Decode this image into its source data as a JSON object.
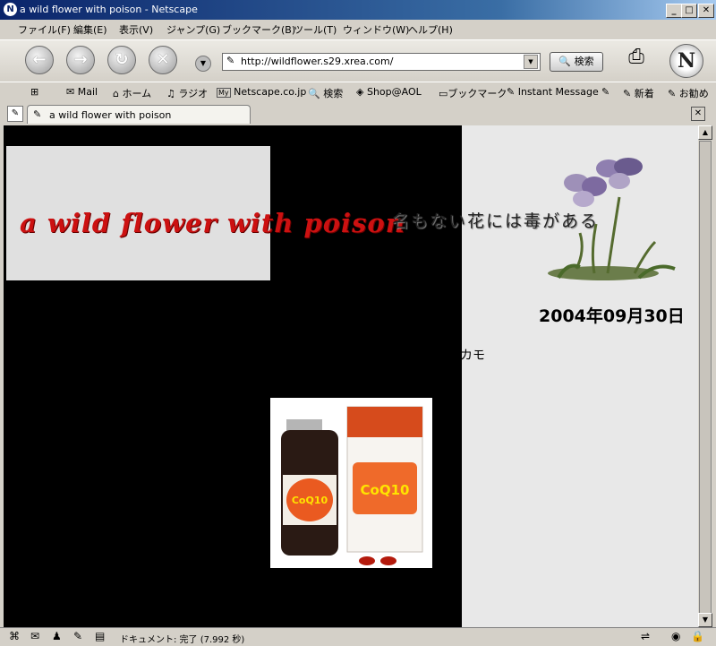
{
  "window": {
    "title": "a wild flower with poison - Netscape"
  },
  "menu": [
    "ファイル(F)",
    "編集(E)",
    "表示(V)",
    "ジャンプ(G)",
    "ブックマーク(B)",
    "ツール(T)",
    "ウィンドウ(W)",
    "ヘルプ(H)"
  ],
  "nav": {
    "url": "http://wildflower.s29.xrea.com/",
    "search_label": "検索"
  },
  "personal_toolbar": [
    "Mail",
    "ホーム",
    "ラジオ",
    "Netscape.co.jp",
    "検索",
    "Shop@AOL",
    "ブックマーク",
    "Instant Message",
    "新着",
    "お勧め"
  ],
  "tab": {
    "label": "a wild flower with poison"
  },
  "page": {
    "banner_title": "a wild flower with poison",
    "tagline": "名もない花には毒がある",
    "date": "2004年09月30日",
    "fragment_text": "カモ",
    "product_label": "CoQ10"
  },
  "status": {
    "text": "ドキュメント: 完了 (7.992 秒)"
  },
  "colors": {
    "banner_red": "#cc1111",
    "page_bg": "#000000",
    "sidebar_bg": "#e8e8e8"
  }
}
